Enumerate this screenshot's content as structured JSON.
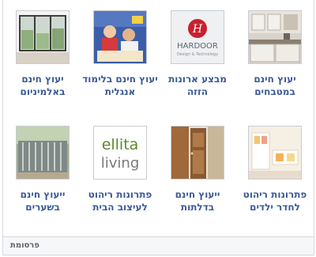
{
  "ads": [
    {
      "label": "יעוץ חינם במטבחים",
      "image": "kitchen-photo"
    },
    {
      "label": "מבצע ארונות הזזה",
      "image": "hardoor-logo",
      "logo_text": "HARDOOR",
      "logo_sub": "Design & Technology"
    },
    {
      "label": "יעוץ חינם בלימוד אנגלית",
      "image": "english-students-photo"
    },
    {
      "label": "יעוץ חינם באלמיניום",
      "image": "aluminum-windows-photo"
    },
    {
      "label": "פתרונות ריהוט לחדר ילדים",
      "image": "kids-room-photo"
    },
    {
      "label": "ייעוץ חינם בדלתות",
      "image": "doors-photo"
    },
    {
      "label": "פתרונות ריהוט לעיצוב הבית",
      "image": "ellita-living-logo",
      "logo_line1": "ellita",
      "logo_line2": "living"
    },
    {
      "label": "ייעוץ חינם בשערים",
      "image": "gates-photo"
    }
  ],
  "footer": {
    "label": "פרסומת"
  },
  "colors": {
    "link": "#3b5998",
    "border": "#d6d9de",
    "footer_bg": "#f6f7f9"
  }
}
